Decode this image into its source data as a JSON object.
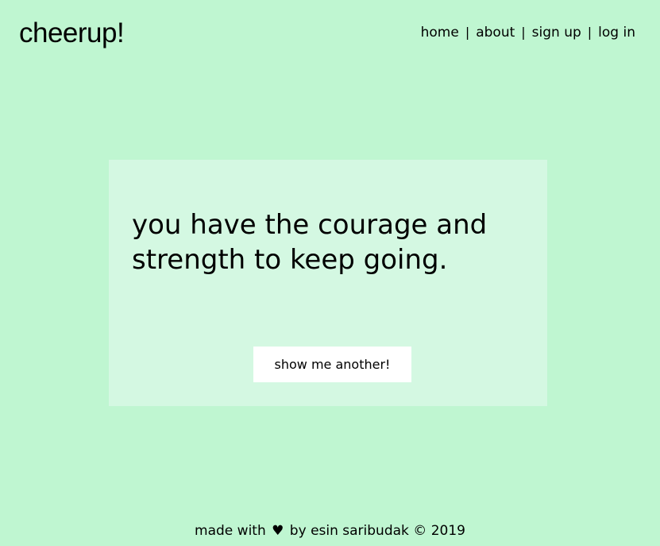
{
  "header": {
    "logo": "cheerup!",
    "nav": {
      "home": "home",
      "about": "about",
      "signup": "sign up",
      "login": "log in",
      "separator": "|"
    }
  },
  "card": {
    "quote": "you have the courage and strength to keep going.",
    "button_label": "show me another!"
  },
  "footer": {
    "made_with": "made with",
    "heart_icon": "heart-icon",
    "heart_glyph": "♥",
    "by": "by",
    "author": "esin saribudak",
    "copyright": "© 2019"
  },
  "colors": {
    "background": "#bff6d1",
    "card": "#d4f8e2",
    "button": "#ffffff",
    "text": "#000000"
  }
}
